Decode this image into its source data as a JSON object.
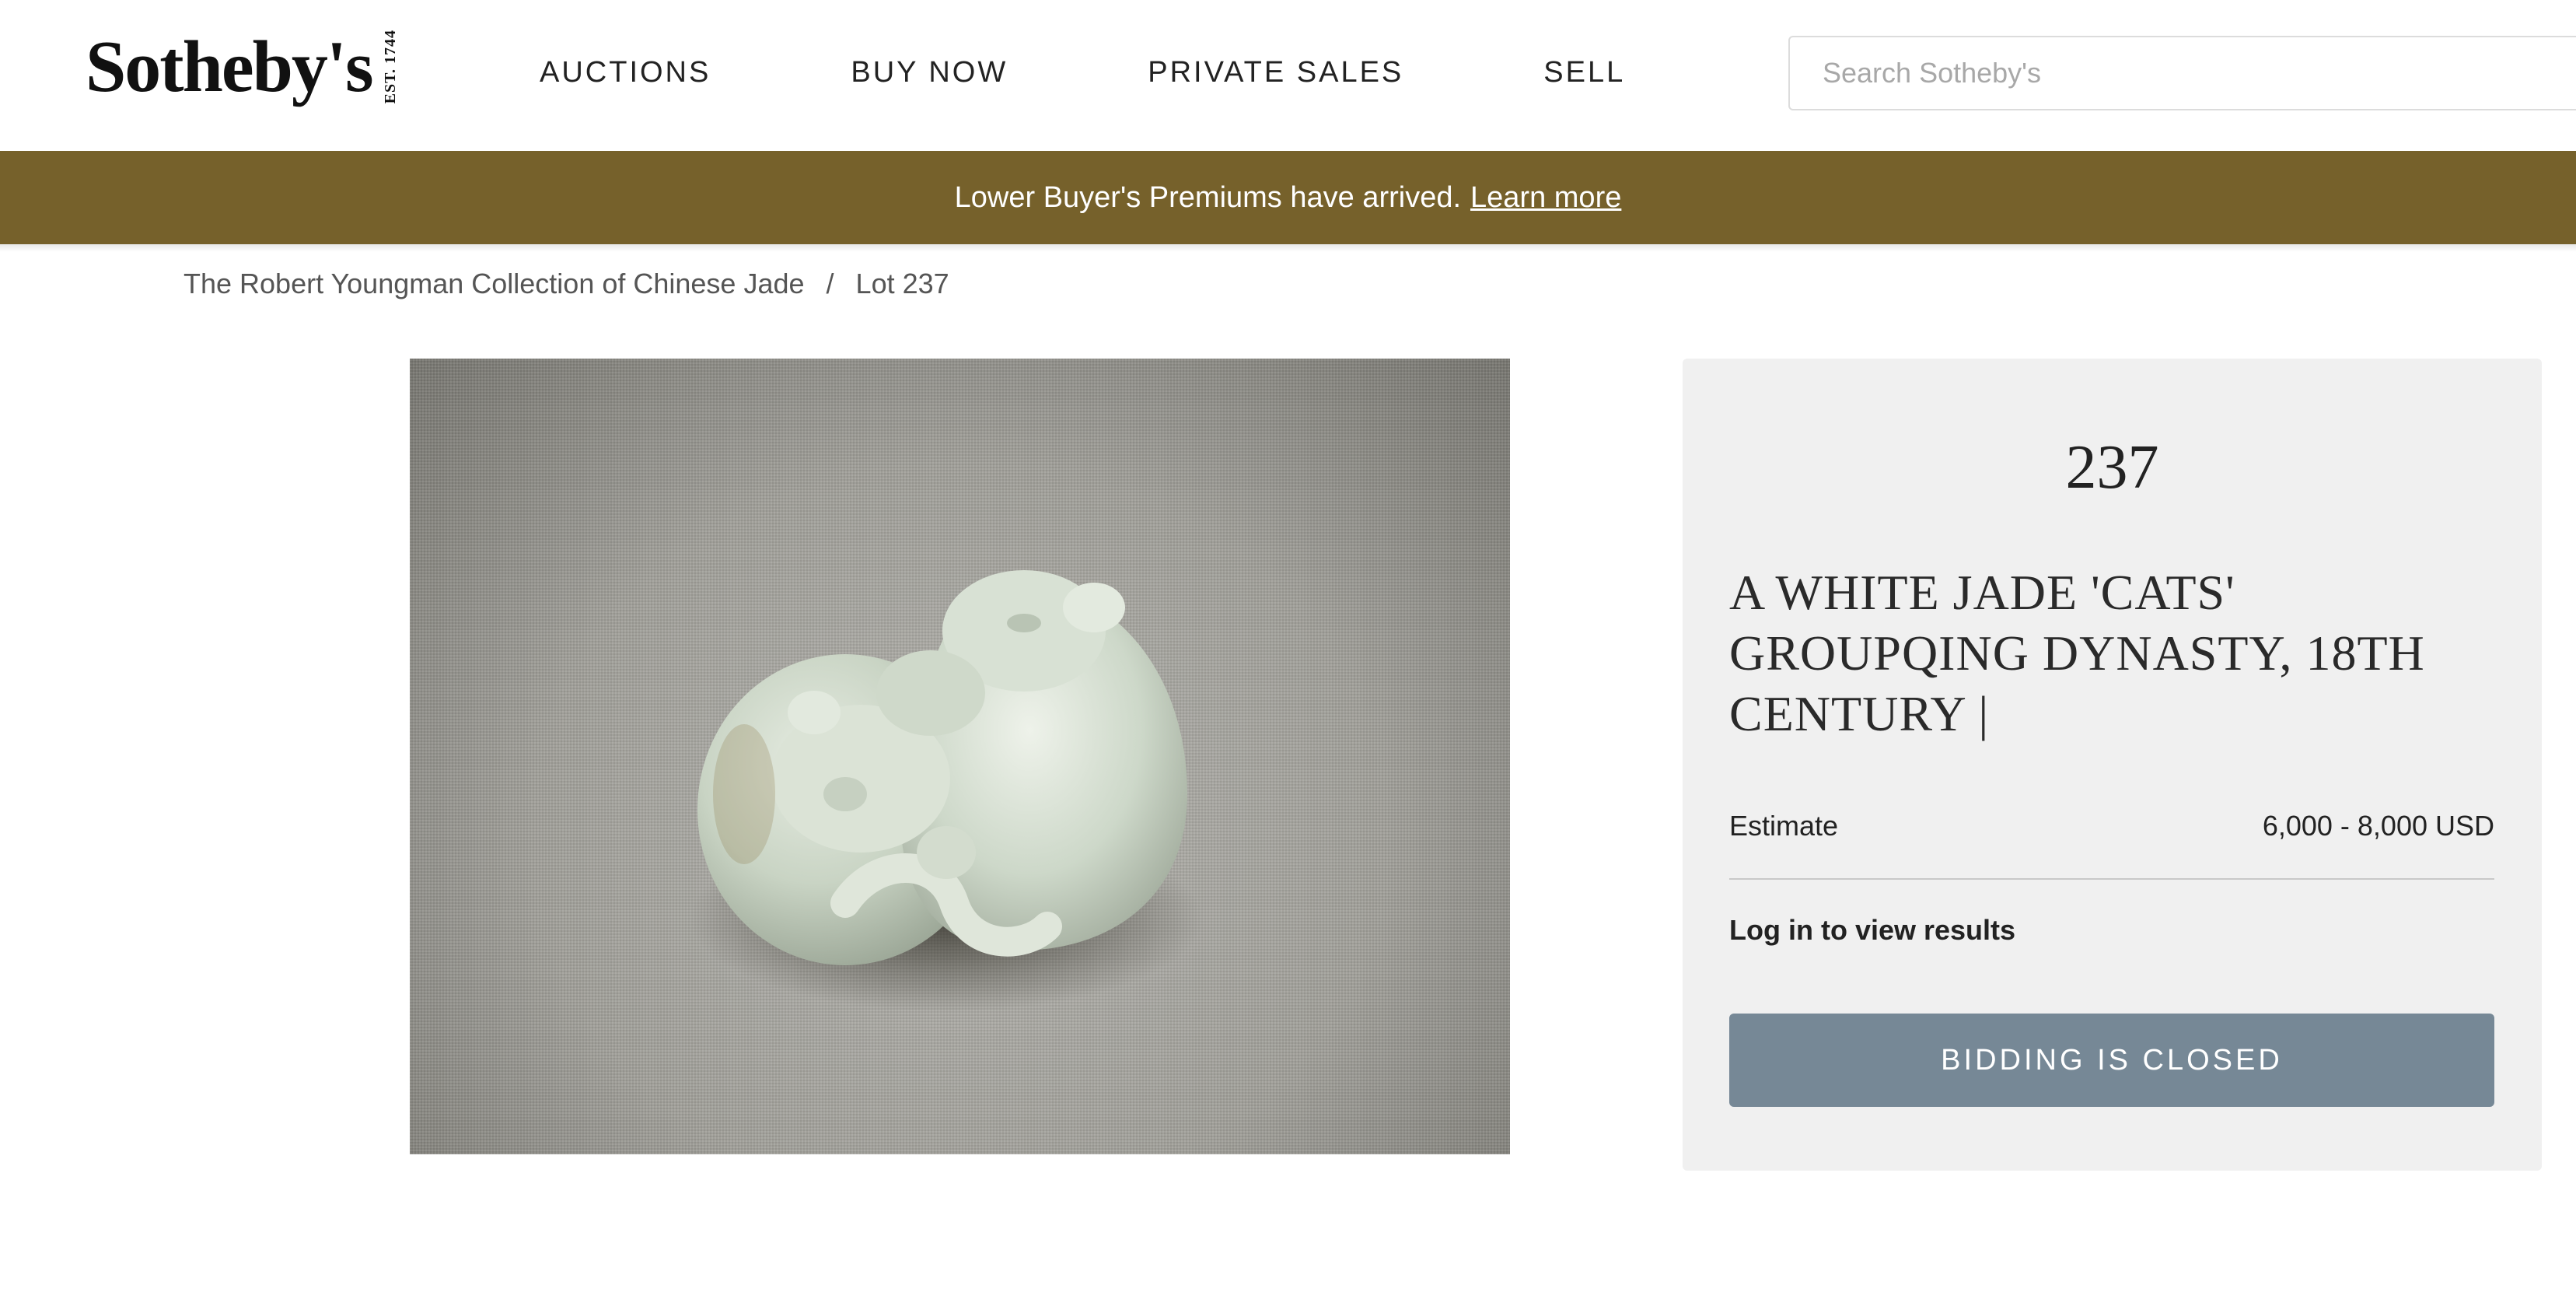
{
  "header": {
    "logo_text": "Sotheby's",
    "logo_est": "EST. 1744",
    "nav": [
      {
        "label": "AUCTIONS"
      },
      {
        "label": "BUY NOW"
      },
      {
        "label": "PRIVATE SALES"
      },
      {
        "label": "SELL"
      }
    ],
    "search_placeholder": "Search Sotheby's"
  },
  "banner": {
    "text": "Lower Buyer's Premiums have arrived.",
    "link": "Learn more",
    "color": "#76612b"
  },
  "breadcrumb": {
    "collection": "The Robert Youngman Collection of Chinese Jade",
    "separator": "/",
    "current": "Lot 237"
  },
  "lot": {
    "number": "237",
    "title": "A WHITE JADE 'CATS' GROUPQING DYNASTY, 18TH CENTURY |",
    "estimate_label": "Estimate",
    "estimate_value": "6,000 - 8,000 USD",
    "results_link": "Log in to view results",
    "bid_button": "BIDDING IS CLOSED",
    "button_color": "#768896"
  }
}
